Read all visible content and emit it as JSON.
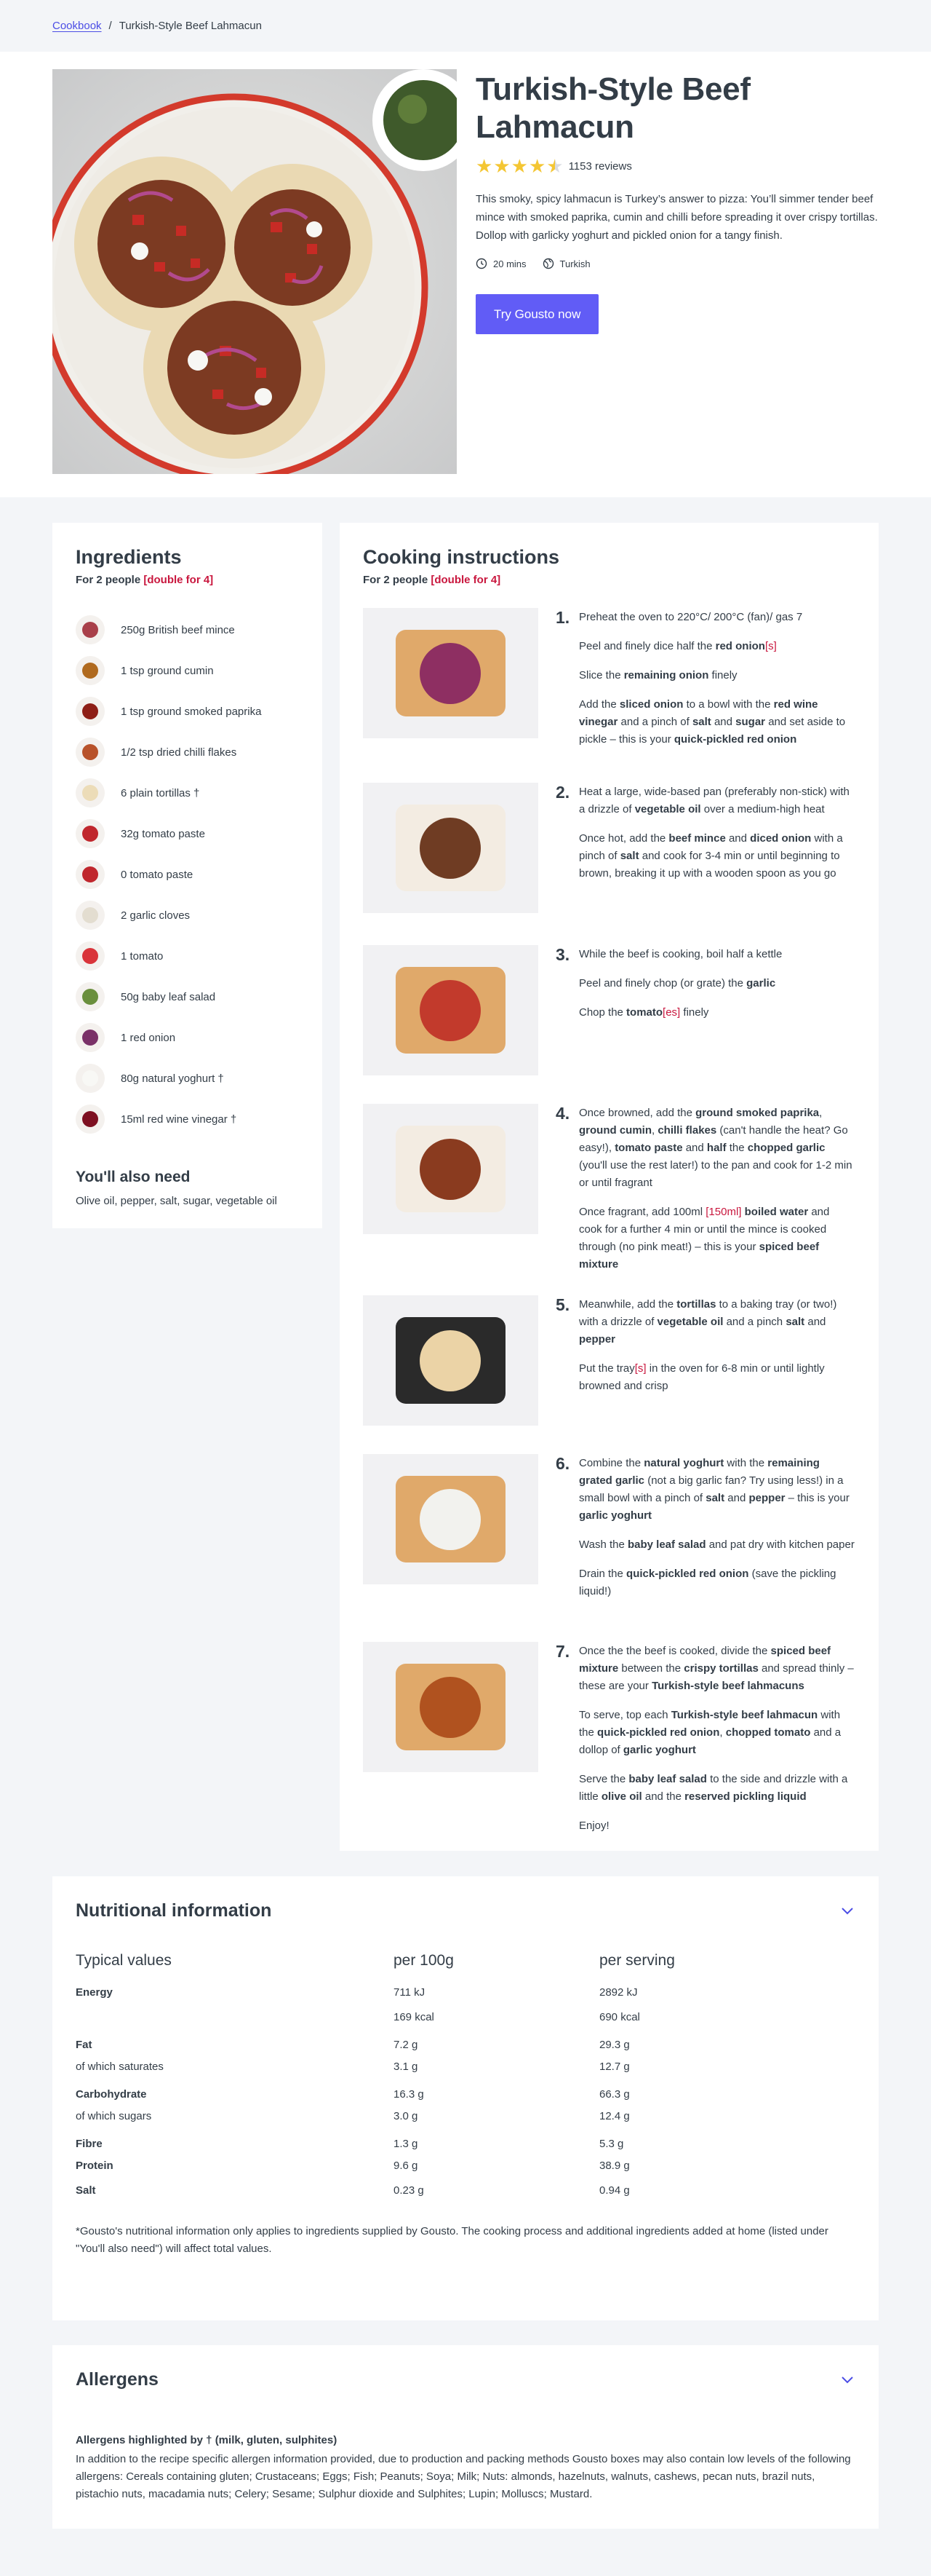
{
  "breadcrumb": {
    "link": "Cookbook",
    "separator": "/",
    "current": "Turkish-Style Beef Lahmacun"
  },
  "hero": {
    "title": "Turkish-Style Beef Lahmacun",
    "rating": 4.5,
    "reviews": "1153 reviews",
    "description": "This smoky, spicy lahmacun is Turkey’s answer to pizza: You’ll simmer tender beef mince with smoked paprika, cumin and chilli before spreading it over crispy tortillas. Dollop with garlicky yoghurt and pickled onion for a tangy finish.",
    "time": "20 mins",
    "cuisine": "Turkish",
    "cta": "Try Gousto now",
    "image_alt": "turkish-style-beef-lahmacun-photo"
  },
  "ingredients": {
    "title": "Ingredients",
    "servings_prefix": "For 2 people ",
    "servings_double": "[double for 4]",
    "items": [
      {
        "name": "250g British beef mince",
        "color": "#a9404a"
      },
      {
        "name": "1 tsp ground cumin",
        "color": "#b06a1f"
      },
      {
        "name": "1 tsp ground smoked paprika",
        "color": "#8e1f17"
      },
      {
        "name": "1/2 tsp dried chilli flakes",
        "color": "#b8522a"
      },
      {
        "name": "6 plain tortillas †",
        "color": "#ecdcb8"
      },
      {
        "name": "32g tomato paste",
        "color": "#c0272d"
      },
      {
        "name": "0 tomato paste",
        "color": "#c0272d"
      },
      {
        "name": "2 garlic cloves",
        "color": "#e3ddd0"
      },
      {
        "name": "1 tomato",
        "color": "#d9343a"
      },
      {
        "name": "50g baby leaf salad",
        "color": "#6a8f3d"
      },
      {
        "name": "1 red onion",
        "color": "#7a3168"
      },
      {
        "name": "80g natural yoghurt †",
        "color": "#f8f8f5"
      },
      {
        "name": "15ml red wine vinegar †",
        "color": "#7e1021"
      }
    ],
    "also_title": "You'll also need",
    "also_text": "Olive oil, pepper, salt, sugar, vegetable oil"
  },
  "instructions": {
    "title": "Cooking instructions",
    "servings_prefix": "For 2 people ",
    "servings_double": "[double for 4]",
    "steps": [
      {
        "num": "1.",
        "paras": [
          "Preheat the oven to 220°C/ 200°C (fan)/ gas 7",
          "Peel and finely dice half the <b>red onion</b><span class=\"dbl\">[s]</span>",
          "Slice the <b>remaining onion</b> finely",
          "Add the <b>sliced onion</b> to a bowl with the <b>red wine vinegar</b> and a pinch of <b>salt</b> and <b>sugar</b> and set aside to pickle – this is your <b>quick-pickled red onion</b>"
        ]
      },
      {
        "num": "2.",
        "paras": [
          "Heat a large, wide-based pan (preferably non-stick) with a drizzle of <b>vegetable oil</b> over a medium-high heat",
          "Once hot, add the <b>beef mince</b> and <b>diced onion</b> with a pinch of <b>salt</b> and cook for 3-4 min or until beginning to brown, breaking it up with a wooden spoon as you go"
        ]
      },
      {
        "num": "3.",
        "paras": [
          "While the beef is cooking, boil half a kettle",
          "Peel and finely chop (or grate) the <b>garlic</b>",
          "Chop the <b>tomato</b><span class=\"dbl\">[es]</span> finely"
        ]
      },
      {
        "num": "4.",
        "paras": [
          "Once browned, add the <b>ground smoked paprika</b>, <b>ground cumin</b>, <b>chilli flakes</b> (can't handle the heat? Go easy!), <b>tomato paste</b> and <b>half</b> the <b>chopped garlic</b> (you'll use the rest later!) to the pan and cook for 1-2 min or until fragrant",
          "Once fragrant, add 100ml <span class=\"dbl\">[150ml]</span> <b>boiled water</b> and cook for a further 4 min or until the mince is cooked through (no pink meat!) – this is your <b>spiced beef mixture</b>"
        ]
      },
      {
        "num": "5.",
        "paras": [
          "Meanwhile, add the <b>tortillas</b> to a baking tray (or two!) with a drizzle of <b>vegetable oil</b> and a pinch <b>salt</b> and <b>pepper</b>",
          "Put the tray<span class=\"dbl\">[s]</span> in the oven for 6-8 min or until lightly browned and crisp"
        ]
      },
      {
        "num": "6.",
        "paras": [
          "Combine the <b>natural yoghurt</b> with the <b>remaining grated garlic</b> (not a big garlic fan? Try using less!) in a small bowl with a pinch of <b>salt</b> and <b>pepper</b> – this is your <b>garlic yoghurt</b>",
          "Wash the <b>baby leaf salad</b> and pat dry with kitchen paper",
          "Drain the <b>quick-pickled red onion</b> (save the pickling liquid!)"
        ]
      },
      {
        "num": "7.",
        "paras": [
          "Once the the beef is cooked, divide the <b>spiced beef mixture</b> between the <b>crispy tortillas</b> and spread thinly – these are your <b>Turkish-style beef lahmacuns</b>",
          "To serve, top each <b>Turkish-style beef lahmacun</b> with the <b>quick-pickled red onion</b>, <b>chopped tomato</b> and a dollop of <b>garlic yoghurt</b>",
          "Serve the <b>baby leaf salad</b> to the side and drizzle with a little <b>olive oil</b> and the <b>reserved pickling liquid</b>",
          "Enjoy!"
        ]
      }
    ]
  },
  "nutrition": {
    "title": "Nutritional information",
    "headers": [
      "Typical values",
      "per 100g",
      "per serving"
    ],
    "rows": [
      {
        "label": "Energy",
        "strong": true,
        "per100": "711 kJ",
        "serving": "2892 kJ"
      },
      {
        "label": "",
        "strong": false,
        "per100": "169 kcal",
        "serving": "690 kcal"
      },
      {
        "label": "Fat",
        "strong": true,
        "per100": "7.2 g",
        "serving": "29.3 g"
      },
      {
        "label": "of which saturates",
        "strong": false,
        "per100": "3.1 g",
        "serving": "12.7 g"
      },
      {
        "label": "Carbohydrate",
        "strong": true,
        "per100": "16.3 g",
        "serving": "66.3 g"
      },
      {
        "label": "of which sugars",
        "strong": false,
        "per100": "3.0 g",
        "serving": "12.4 g"
      },
      {
        "label": "Fibre",
        "strong": true,
        "per100": "1.3 g",
        "serving": "5.3 g"
      },
      {
        "label": "Protein",
        "strong": true,
        "per100": "9.6 g",
        "serving": "38.9 g"
      },
      {
        "label": "Salt",
        "strong": true,
        "per100": "0.23 g",
        "serving": "0.94 g"
      }
    ],
    "note": "*Gousto's nutritional information only applies to ingredients supplied by Gousto. The cooking process and additional ingredients added at home (listed under \"You'll also need\") will affect total values."
  },
  "allergens": {
    "title": "Allergens",
    "highlight": "Allergens highlighted by † (milk, gluten, sulphites)",
    "text": "In addition to the recipe specific allergen information provided, due to production and packing methods Gousto boxes may also contain low levels of the following allergens: Cereals containing gluten; Crustaceans; Eggs; Fish; Peanuts; Soya; Milk; Nuts: almonds, hazelnuts, walnuts, cashews, pecan nuts, brazil nuts, pistachio nuts, macadamia nuts; Celery; Sesame; Sulphur dioxide and Sulphites; Lupin; Molluscs; Mustard."
  },
  "colors": {
    "accent": "#615cf6",
    "link": "#4b4de5",
    "double": "#c9173e",
    "star": "#f4c633"
  }
}
